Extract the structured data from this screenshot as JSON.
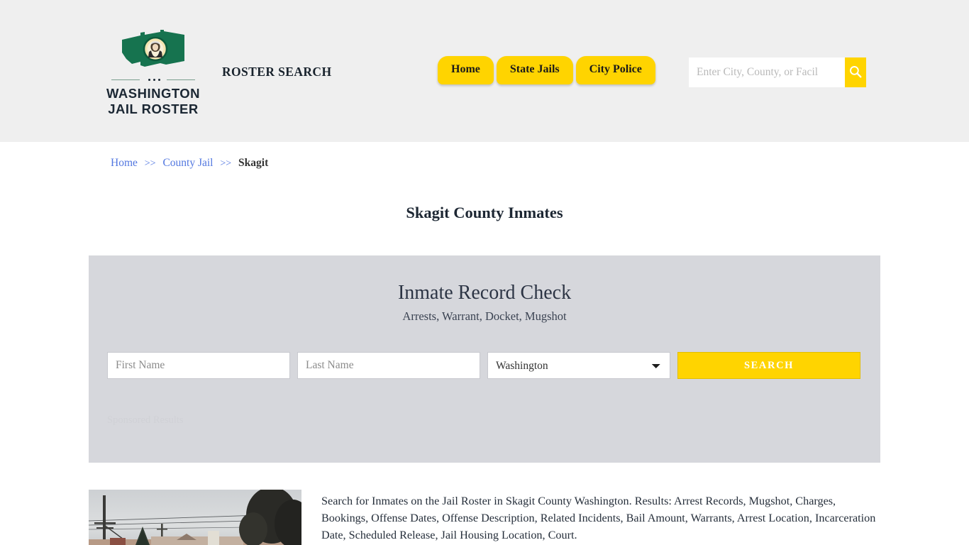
{
  "header": {
    "logo": {
      "icon": "washington-state-flag-icon",
      "line1": "WASHINGTON",
      "line2": "JAIL ROSTER"
    },
    "site_tagline": "ROSTER SEARCH",
    "nav": [
      {
        "label": "Home",
        "name": "nav-home"
      },
      {
        "label": "State Jails",
        "name": "nav-state-jails"
      },
      {
        "label": "City Police",
        "name": "nav-city-police"
      }
    ],
    "search": {
      "placeholder": "Enter City, County, or Facil",
      "value": "",
      "button_icon": "search-icon"
    },
    "background_color": "#efefef"
  },
  "breadcrumb": {
    "items": [
      {
        "label": "Home",
        "link": true
      },
      {
        "label": "County Jail",
        "link": true
      },
      {
        "label": "Skagit",
        "link": false
      }
    ],
    "separator": ">>",
    "link_color": "#5277e0"
  },
  "page": {
    "title": "Skagit County Inmates"
  },
  "panel": {
    "title": "Inmate Record Check",
    "subtitle": "Arrests, Warrant, Docket, Mugshot",
    "background_color": "#d6d7dc",
    "form": {
      "first_name_placeholder": "First Name",
      "first_name_value": "",
      "last_name_placeholder": "Last Name",
      "last_name_value": "",
      "state_selected": "Washington",
      "state_options": [
        "Washington"
      ],
      "search_button_label": "SEARCH",
      "search_button_color": "#ffd400"
    },
    "sponsored_label": "Sponsored Results"
  },
  "content": {
    "photo_alt": "skagit-county-jail-photo",
    "description": "Search for Inmates on the Jail Roster in Skagit County Washington. Results: Arrest Records, Mugshot, Charges, Bookings, Offense Dates, Offense Description, Related Incidents, Bail Amount, Warrants, Arrest Location, Incarceration Date, Scheduled Release, Jail Housing Location, Court."
  }
}
